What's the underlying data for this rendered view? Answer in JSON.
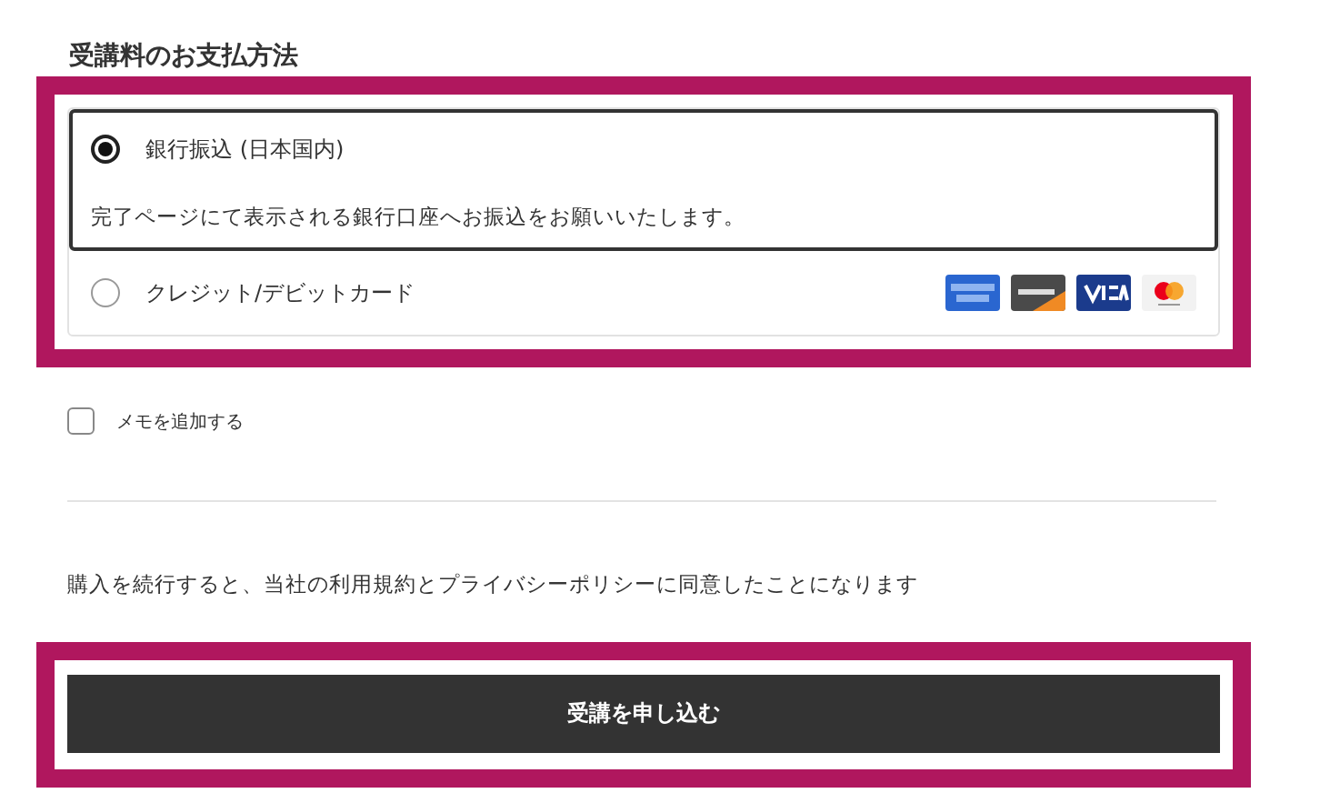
{
  "heading": "受講料のお支払方法",
  "payment_options": [
    {
      "label": "銀行振込 (日本国内)",
      "description": "完了ページにて表示される銀行口座へお振込をお願いいたします。",
      "selected": true,
      "kind": "bank"
    },
    {
      "label": "クレジット/デビットカード",
      "selected": false,
      "kind": "card"
    }
  ],
  "memo": {
    "label": "メモを追加する",
    "checked": false
  },
  "terms": "購入を続行すると、当社の利用規約とプライバシーポリシーに同意したことになります",
  "submit_button": "受講を申し込む"
}
